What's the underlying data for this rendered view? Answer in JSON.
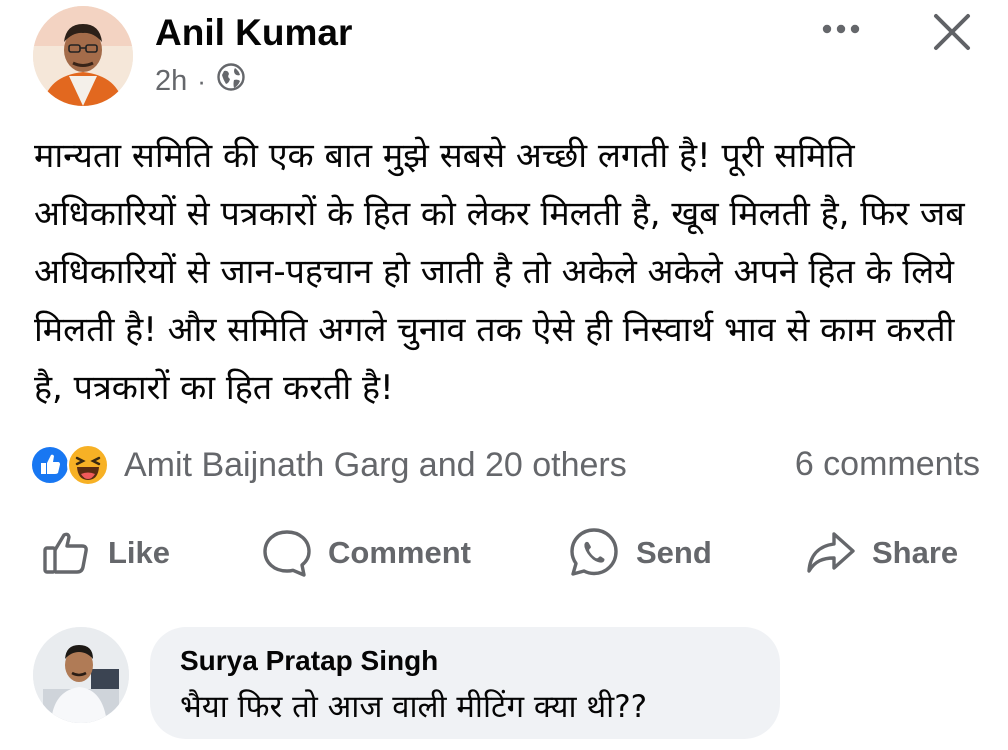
{
  "post": {
    "author_name": "Anil Kumar",
    "timestamp": "2h",
    "separator": "·",
    "audience_icon": "globe-icon",
    "text": "मान्यता समिति की एक बात मुझे सबसे अच्छी लगती है! पूरी समिति अधिकारियों से पत्रकारों के हित को लेकर मिलती है, खूब मिलती है, फिर जब अधिकारियों से जान-पहचान हो जाती है तो अकेले अकेले अपने हित के लिये मिलती है! और समिति अगले चुनाव तक ऐसे ही निस्वार्थ भाव से काम करती है, पत्रकारों का हित करती है!"
  },
  "header_icons": {
    "more": "ellipsis-icon",
    "close": "close-icon"
  },
  "reactions": {
    "icons": [
      "like-reaction-icon",
      "haha-reaction-icon"
    ],
    "summary": "Amit Baijnath Garg and 20 others",
    "comments_count": "6 comments"
  },
  "actions": {
    "like": "Like",
    "comment": "Comment",
    "send": "Send",
    "share": "Share"
  },
  "comment": {
    "author_name": "Surya Pratap Singh",
    "text": "भैया फिर तो आज वाली मीटिंग क्या थी??"
  },
  "colors": {
    "text": "#050505",
    "secondary": "#65676b",
    "like_blue": "#1877f2",
    "haha_yellow": "#f7b125",
    "bubble_bg": "#f0f2f5"
  }
}
